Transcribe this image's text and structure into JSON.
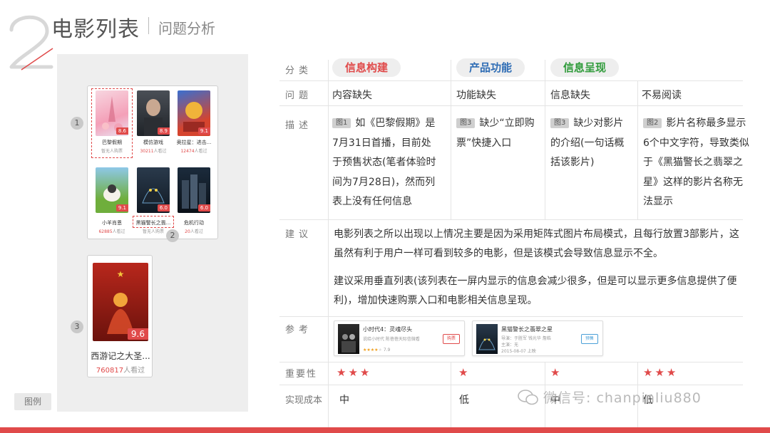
{
  "header": {
    "number": "2",
    "title": "电影列表",
    "subtitle": "问题分析"
  },
  "colors": {
    "accent": "#e04a4a",
    "info_build": "#e04a4a",
    "product_feature": "#2f6db5",
    "info_present": "#2f9b3a"
  },
  "legend_label": "图例",
  "phone_grid": {
    "movies": [
      {
        "name": "巴黎假期",
        "score": "8.6",
        "views_num": "",
        "views_text": "暂无人购票"
      },
      {
        "name": "模仿游戏",
        "score": "8.9",
        "views_num": "30211",
        "views_text": "人看过"
      },
      {
        "name": "奥拉星：进击...",
        "score": "9.1",
        "views_num": "12474",
        "views_text": "人看过"
      },
      {
        "name": "小羊肖恩",
        "score": "9.1",
        "views_num": "62885",
        "views_text": "人看过"
      },
      {
        "name": "黑猫警长之翡...",
        "score": "6.0",
        "views_num": "",
        "views_text": "暂无人购票"
      },
      {
        "name": "危机行动",
        "score": "6.0",
        "views_num": "20",
        "views_text": "人看过"
      }
    ],
    "markers": [
      "1",
      "2",
      "3"
    ]
  },
  "phone_single": {
    "name": "西游记之大圣...",
    "score": "9.6",
    "views_num": "760817",
    "views_text": "人看过"
  },
  "table": {
    "row_labels": {
      "category": "分类",
      "problem": "问题",
      "desc": "描述",
      "suggest": "建议",
      "reference": "参考",
      "importance": "重要性",
      "cost": "实现成本"
    },
    "categories": [
      "信息构建",
      "产品功能",
      "信息呈现"
    ],
    "problems": [
      "内容缺失",
      "功能缺失",
      "信息缺失",
      "不易阅读"
    ],
    "descriptions": [
      {
        "tag": "图1",
        "text": "如《巴黎假期》是7月31日首播，目前处于预售状态(笔者体验时间为7月28日)，然而列表上没有任何信息"
      },
      {
        "tag": "图3",
        "text": "缺少“立即购票”快捷入口"
      },
      {
        "tag": "图3",
        "text": "缺少对影片的介绍(一句话概括该影片)"
      },
      {
        "tag": "图2",
        "text": "影片名称最多显示6个中文字符，导致类似于《黑猫警长之翡翠之星》这样的影片名称无法显示"
      }
    ],
    "suggestions": [
      "电影列表之所以出现以上情况主要是因为采用矩阵式图片布局模式，且每行放置3部影片，这虽然有利于用户一样可看到较多的电影，但是该模式会导致信息显示不全。",
      "建议采用垂直列表(该列表在一屏内显示的信息会减少很多，但是可以显示更多信息提供了便利)，增加快速购票入口和电影相关信息呈现。"
    ],
    "references": [
      {
        "title": "小时代4：灵魂尽头",
        "line1": "说给小时代 陈蓓蓓天际信微看",
        "line2": "7.9",
        "button": "购票"
      },
      {
        "title": "黑猫警长之翡翠之星",
        "line1": "导演：于胜军 钱光华 詹皓",
        "line2": "主演：无",
        "line3": "2015-08-07 上映",
        "button": "预售"
      }
    ],
    "importance": [
      "★★★",
      "★",
      "★",
      "★★★"
    ],
    "cost": [
      "中",
      "低",
      "中",
      "低"
    ]
  },
  "watermark": "微信号: chanpinliu880"
}
